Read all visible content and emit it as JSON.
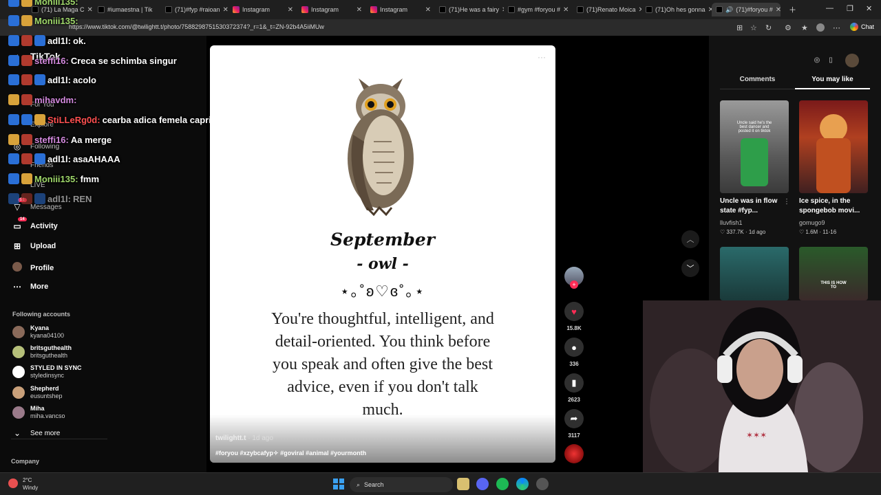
{
  "browser": {
    "tabs": [
      {
        "label": "(71) La Maga C",
        "active": false
      },
      {
        "label": "#iumaestna | Tik",
        "active": false
      },
      {
        "label": "(71)#fyp #raioan",
        "active": false
      },
      {
        "label": "Instagram",
        "active": false
      },
      {
        "label": "Instagram",
        "active": false
      },
      {
        "label": "Instagram",
        "active": false
      },
      {
        "label": "(71)He was a fairy",
        "active": false
      },
      {
        "label": "#gym #foryou #",
        "active": false
      },
      {
        "label": "(71)Renato Moica",
        "active": false
      },
      {
        "label": "(71)Oh hes gonna",
        "active": false
      },
      {
        "label": "(71)#foryou #",
        "active": true
      }
    ],
    "url": "https://www.tiktok.com/@twilightt.t/photo/7588298751530372374?_r=1&_t=ZN-92b4A5iiMUw",
    "chat_label": "Chat"
  },
  "sidebar": {
    "logo": "TikTok",
    "nav": [
      {
        "label": "For You",
        "icon": "home-icon"
      },
      {
        "label": "Explore",
        "icon": "compass-icon"
      },
      {
        "label": "Following",
        "icon": "following-icon"
      },
      {
        "label": "Friends",
        "icon": "friends-icon"
      },
      {
        "label": "LIVE",
        "icon": "live-icon"
      },
      {
        "label": "Messages",
        "icon": "message-icon",
        "badge": "51"
      },
      {
        "label": "Activity",
        "icon": "activity-icon",
        "badge": "14"
      },
      {
        "label": "Upload",
        "icon": "upload-icon"
      },
      {
        "label": "Profile",
        "icon": "profile-icon"
      },
      {
        "label": "More",
        "icon": "more-icon"
      }
    ],
    "following_title": "Following accounts",
    "accounts": [
      {
        "name": "Kyana",
        "handle": "kyana04100"
      },
      {
        "name": "britsguthealth",
        "handle": "britsguthealth"
      },
      {
        "name": "STYLED IN SYNC",
        "handle": "styledinsync"
      },
      {
        "name": "Shepherd",
        "handle": "eusuntshep"
      },
      {
        "name": "Miha",
        "handle": "miha.vancso"
      }
    ],
    "see_more": "See more",
    "company": "Company"
  },
  "chat_overlay": [
    {
      "user": "Moniii135:",
      "msg": ""
    },
    {
      "user": "Moniii135:",
      "msg": ""
    },
    {
      "user": "adl1l:",
      "msg": "ok."
    },
    {
      "user": "steffi16:",
      "msg": "Creca se schimba singur"
    },
    {
      "user": "adl1l:",
      "msg": "acolo"
    },
    {
      "user": "mihavdm:",
      "msg": ""
    },
    {
      "user": "StiLLeRg0d:",
      "msg": "cearba adica femela caprioara"
    },
    {
      "user": "steffi16:",
      "msg": "Aa merge"
    },
    {
      "user": "adl1l:",
      "msg": "asaAHAAA"
    },
    {
      "user": "Moniii135:",
      "msg": "fmm"
    },
    {
      "user": "adl1l:",
      "msg": "REN"
    }
  ],
  "video": {
    "month": "September",
    "animal": "- owl -",
    "decoration": "⋆｡˚ʚ♡ɞ˚｡⋆",
    "description": "You're thoughtful, intelligent, and detail-oriented. You think before you speak and often give the best advice, even if you don't talk much.",
    "author": "twilightt.t",
    "date": "· 1d ago",
    "hashtags": "#foryou #xzybcafyp✧ #goviral #animal #yourmonth",
    "more": "···"
  },
  "actions": {
    "likes": "15.8K",
    "comments": "336",
    "saves": "2623",
    "shares": "3117"
  },
  "right_panel": {
    "tabs": [
      {
        "label": "Comments",
        "active": false
      },
      {
        "label": "You may like",
        "active": true
      }
    ],
    "cards": [
      {
        "title": "Uncle was in flow state #fyp...",
        "user": "lluvfish1",
        "meta": "♡ 337.7K · 1d ago",
        "thumb_text": "Uncle said he's the best dancer and posted it on tiktok"
      },
      {
        "title": "Ice spice, in the spongebob movi...",
        "user": "gomugo9",
        "meta": "♡ 1.6M · 11-16",
        "thumb_text": ""
      },
      {
        "title": "",
        "user": "",
        "meta": "",
        "thumb_text": ""
      },
      {
        "title": "",
        "user": "",
        "meta": "",
        "thumb_text": "THIS IS HOW TO"
      }
    ]
  },
  "taskbar": {
    "temp": "2°C",
    "weather": "Windy",
    "search": "Search"
  },
  "colors": {
    "accent_pink": "#fe2c55",
    "sidebar_bg": "#0b0b0b",
    "panel_bg": "#121212"
  }
}
